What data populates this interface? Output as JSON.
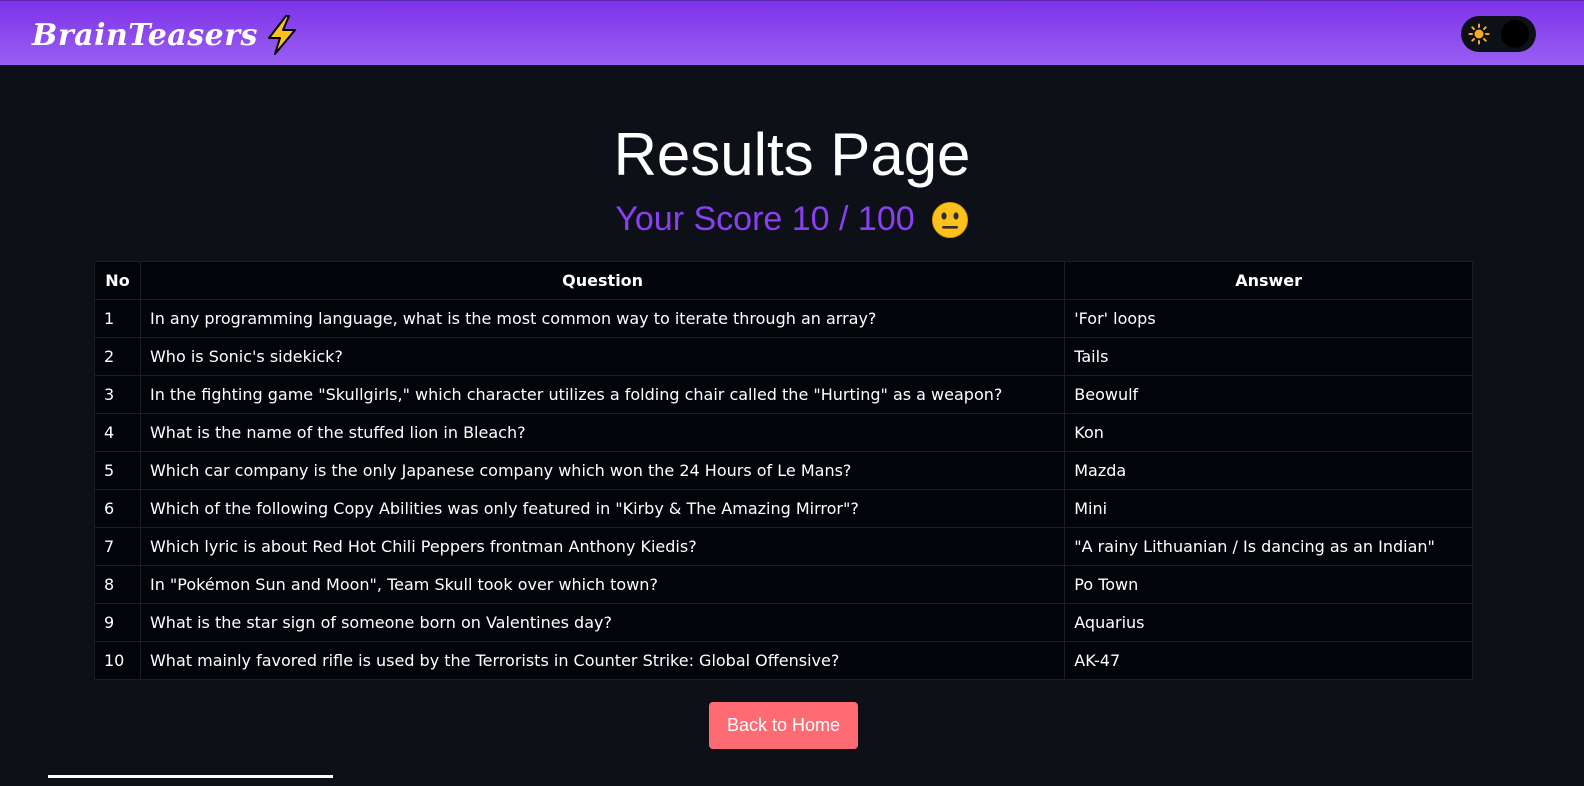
{
  "navbar": {
    "brand": "BrainTeasers",
    "brand_icon": "lightning-bolt-icon",
    "theme_toggle_icon": "sun-icon"
  },
  "page": {
    "title": "Results Page",
    "score_text": "Your Score 10 / 100",
    "score_emoji": "neutral-face-icon",
    "accent_color": "#8a3ff2"
  },
  "table": {
    "headers": [
      "No",
      "Question",
      "Answer"
    ],
    "rows": [
      {
        "no": "1",
        "question": "In any programming language, what is the most common way to iterate through an array?",
        "answer": "'For' loops"
      },
      {
        "no": "2",
        "question": "Who is Sonic's sidekick?",
        "answer": "Tails"
      },
      {
        "no": "3",
        "question": "In the fighting game \"Skullgirls,\" which character utilizes a folding chair called the \"Hurting\" as a weapon?",
        "answer": "Beowulf"
      },
      {
        "no": "4",
        "question": "What is the name of the stuffed lion in Bleach?",
        "answer": "Kon"
      },
      {
        "no": "5",
        "question": "Which car company is the only Japanese company which won the 24 Hours of Le Mans?",
        "answer": "Mazda"
      },
      {
        "no": "6",
        "question": "Which of the following Copy Abilities was only featured in \"Kirby & The Amazing Mirror\"?",
        "answer": "Mini"
      },
      {
        "no": "7",
        "question": "Which lyric is about Red Hot Chili Peppers frontman Anthony Kiedis?",
        "answer": "\"A rainy Lithuanian / Is dancing as an Indian\""
      },
      {
        "no": "8",
        "question": "In \"Pokémon Sun and Moon\", Team Skull took over which town?",
        "answer": "Po Town"
      },
      {
        "no": "9",
        "question": "What is the star sign of someone born on Valentines day?",
        "answer": "Aquarius"
      },
      {
        "no": "10",
        "question": "What mainly favored rifle is used by the Terrorists in Counter Strike: Global Offensive?",
        "answer": "AK-47"
      }
    ]
  },
  "actions": {
    "back_label": "Back to Home",
    "back_color": "#ff6b72"
  }
}
